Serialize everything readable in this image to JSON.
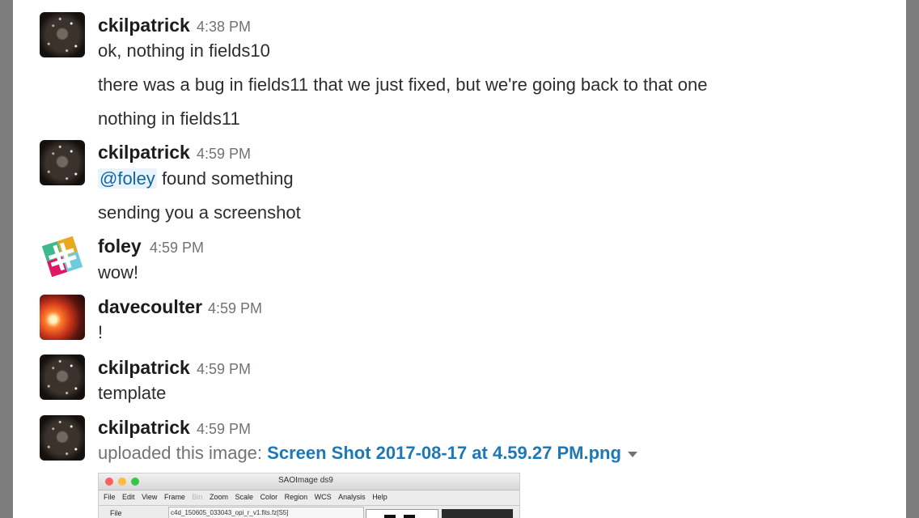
{
  "messages": [
    {
      "avatar": "galaxy-avatar",
      "name": "ckilpatrick",
      "time": "4:38 PM",
      "lines": [
        "ok, nothing in fields10",
        "there was a bug in fields11 that we just fixed, but we're going back to that one",
        "nothing in fields11"
      ]
    },
    {
      "avatar": "galaxy-avatar",
      "name": "ckilpatrick",
      "time": "4:59 PM",
      "mention": "@foley",
      "lines": [
        "found something",
        "sending you a screenshot"
      ]
    },
    {
      "avatar": "slack-logo-avatar",
      "name": "foley",
      "time": "4:59 PM",
      "lines": [
        "wow!"
      ]
    },
    {
      "avatar": "sunset-avatar",
      "name": "davecoulter",
      "time": "4:59 PM",
      "lines": [
        "!"
      ]
    },
    {
      "avatar": "galaxy-avatar",
      "name": "ckilpatrick",
      "time": "4:59 PM",
      "lines": [
        "template"
      ]
    },
    {
      "avatar": "galaxy-avatar",
      "name": "ckilpatrick",
      "time": "4:59 PM",
      "upload_prefix": "uploaded this image:",
      "file_name": "Screen Shot 2017-08-17 at 4.59.27 PM.png",
      "file_menu_icon": "caret-down-icon"
    }
  ],
  "thumbnail": {
    "window_title": "SAOImage ds9",
    "menu": [
      "File",
      "Edit",
      "View",
      "Frame",
      "Bin",
      "Zoom",
      "Scale",
      "Color",
      "Region",
      "WCS",
      "Analysis",
      "Help"
    ],
    "file_label": "File",
    "file_value": "c4d_150605_033043_opi_r_v1.fits.fz[S5]"
  },
  "colors": {
    "mention": "#1264a3",
    "link": "#1d78b8",
    "timestamp": "#717274"
  }
}
